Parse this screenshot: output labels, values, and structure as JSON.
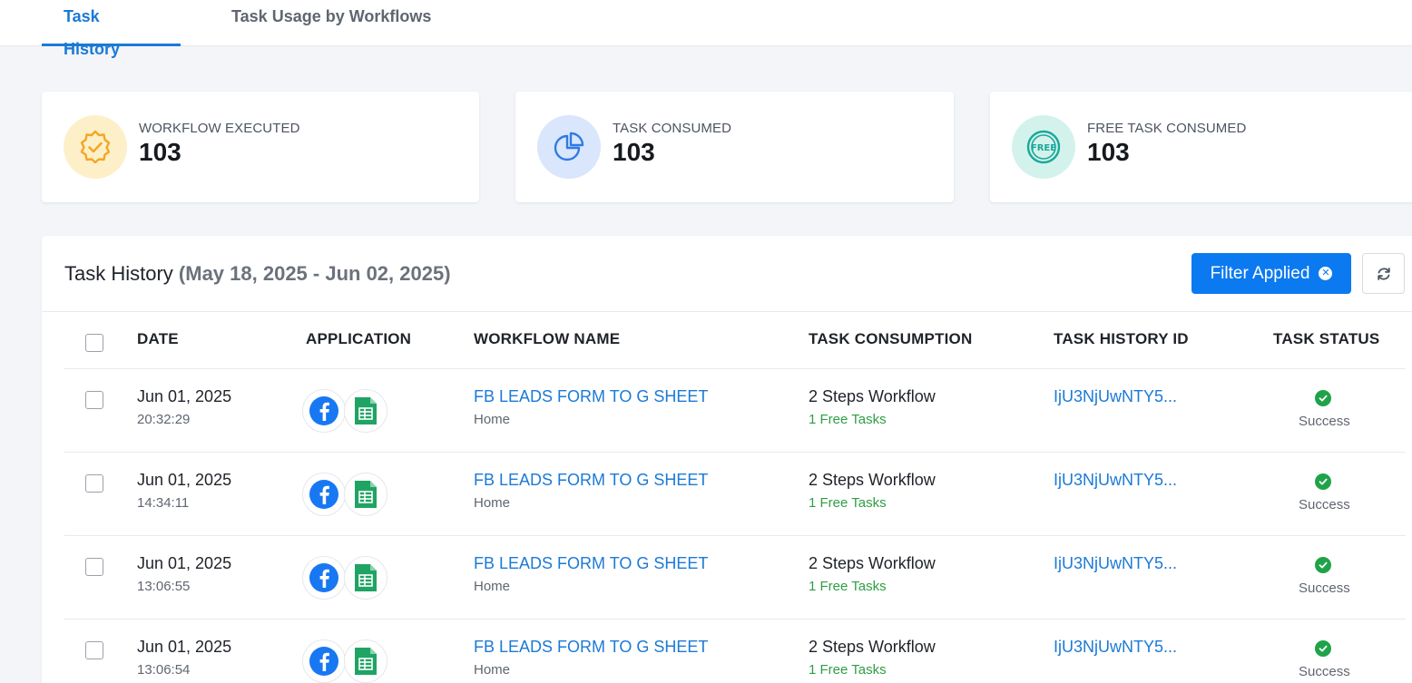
{
  "tabs": [
    {
      "label": "Task History",
      "active": true
    },
    {
      "label": "Task Usage by Workflows",
      "active": false
    }
  ],
  "stats": [
    {
      "label": "WORKFLOW EXECUTED",
      "value": "103",
      "icon": "badge-check-icon",
      "color": "#f5a623",
      "bg": "#fdf0c9"
    },
    {
      "label": "TASK CONSUMED",
      "value": "103",
      "icon": "pie-chart-icon",
      "color": "#2f7be5",
      "bg": "#d9e6fb"
    },
    {
      "label": "FREE TASK CONSUMED",
      "value": "103",
      "icon": "free-icon",
      "color": "#1aa89a",
      "bg": "#d4f2ec"
    }
  ],
  "panel": {
    "title": "Task History",
    "range": "(May 18, 2025 - Jun 02, 2025)",
    "filter_label": "Filter Applied",
    "refresh_icon": "refresh-icon"
  },
  "columns": [
    "DATE",
    "APPLICATION",
    "WORKFLOW NAME",
    "TASK CONSUMPTION",
    "TASK HISTORY ID",
    "TASK STATUS"
  ],
  "rows": [
    {
      "date": "Jun 01, 2025",
      "time": "20:32:29",
      "workflow": "FB LEADS FORM TO G SHEET",
      "folder": "Home",
      "consumption": "2 Steps Workflow",
      "free": "1 Free Tasks",
      "id": "IjU3NjUwNTY5...",
      "status": "Success"
    },
    {
      "date": "Jun 01, 2025",
      "time": "14:34:11",
      "workflow": "FB LEADS FORM TO G SHEET",
      "folder": "Home",
      "consumption": "2 Steps Workflow",
      "free": "1 Free Tasks",
      "id": "IjU3NjUwNTY5...",
      "status": "Success"
    },
    {
      "date": "Jun 01, 2025",
      "time": "13:06:55",
      "workflow": "FB LEADS FORM TO G SHEET",
      "folder": "Home",
      "consumption": "2 Steps Workflow",
      "free": "1 Free Tasks",
      "id": "IjU3NjUwNTY5...",
      "status": "Success"
    },
    {
      "date": "Jun 01, 2025",
      "time": "13:06:54",
      "workflow": "FB LEADS FORM TO G SHEET",
      "folder": "Home",
      "consumption": "2 Steps Workflow",
      "free": "1 Free Tasks",
      "id": "IjU3NjUwNTY5...",
      "status": "Success"
    }
  ],
  "app_icons": [
    "facebook-icon",
    "google-sheets-icon"
  ],
  "colors": {
    "accent": "#1b7ad6",
    "button": "#0b7af0",
    "success": "#1fa34a",
    "free": "#2f9e44"
  }
}
